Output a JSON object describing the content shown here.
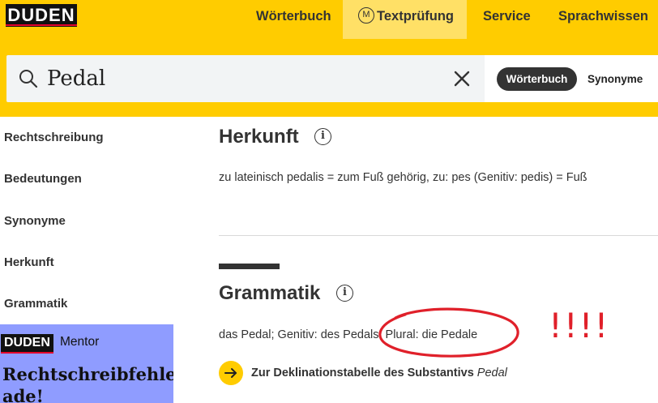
{
  "header": {
    "logo": "DUDEN",
    "nav": {
      "woerterbuch": "Wörterbuch",
      "textpruefung_icon": "M",
      "textpruefung": "Textprüfung",
      "service": "Service",
      "sprachwissen": "Sprachwissen"
    }
  },
  "search": {
    "value": "Pedal",
    "mode_active": "Wörterbuch",
    "mode_other": "Synonyme"
  },
  "sidebar": {
    "items": [
      "Rechtschreibung",
      "Bedeutungen",
      "Synonyme",
      "Herkunft",
      "Grammatik"
    ]
  },
  "ad": {
    "logo": "DUDEN",
    "brand": "Mentor",
    "headline_line1": "Rechtschreibfehler,",
    "headline_line2": "ade!"
  },
  "herkunft": {
    "title": "Herkunft",
    "text": "zu lateinisch pedalis = zum Fuß gehörig, zu: pes (Genitiv: pedis) = Fuß"
  },
  "grammatik": {
    "title": "Grammatik",
    "text": "das Pedal; Genitiv: des Pedals, Plural: die Pedale",
    "link_text": "Zur Deklinationstabelle des Substantivs",
    "link_word": "Pedal"
  },
  "annotation": {
    "marks": "!!!!",
    "color": "#e0202a"
  },
  "colors": {
    "brand_yellow": "#ffcc00",
    "nav_active": "#ffe066",
    "ad_background": "#8f9cff",
    "accent_red": "#e4002b"
  },
  "icons": [
    "search-icon",
    "clear-icon",
    "info-icon",
    "arrow-right-icon",
    "mentor-m-icon"
  ]
}
